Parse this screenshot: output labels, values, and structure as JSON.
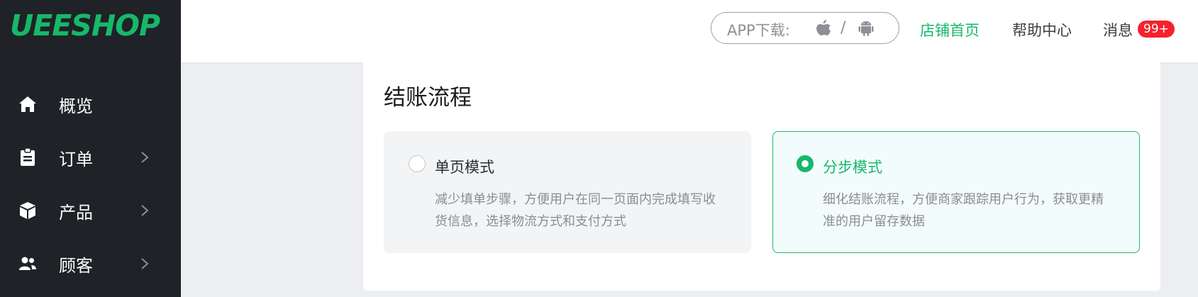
{
  "brand": {
    "logo_text": "UEESHOP",
    "accent": "#16b86a"
  },
  "sidebar": {
    "items": [
      {
        "label": "概览",
        "icon": "home-icon",
        "has_submenu": false
      },
      {
        "label": "订单",
        "icon": "clipboard-icon",
        "has_submenu": true
      },
      {
        "label": "产品",
        "icon": "box-icon",
        "has_submenu": true
      },
      {
        "label": "顾客",
        "icon": "users-icon",
        "has_submenu": true
      }
    ]
  },
  "topbar": {
    "app_download_label": "APP下载:",
    "separator": "/",
    "store_home": "店铺首页",
    "help_center": "帮助中心",
    "messages": "消息",
    "messages_badge": "99+"
  },
  "checkout": {
    "title": "结账流程",
    "options": [
      {
        "title": "单页模式",
        "description": "减少填单步骤，方便用户在同一页面内完成填写收货信息，选择物流方式和支付方式",
        "selected": false
      },
      {
        "title": "分步模式",
        "description": "细化结账流程，方便商家跟踪用户行为，获取更精准的用户留存数据",
        "selected": true
      }
    ]
  },
  "colors": {
    "sidebar_bg": "#1f2226",
    "badge_red": "#f5222d",
    "selected_option_bg": "#f3fcfd"
  }
}
